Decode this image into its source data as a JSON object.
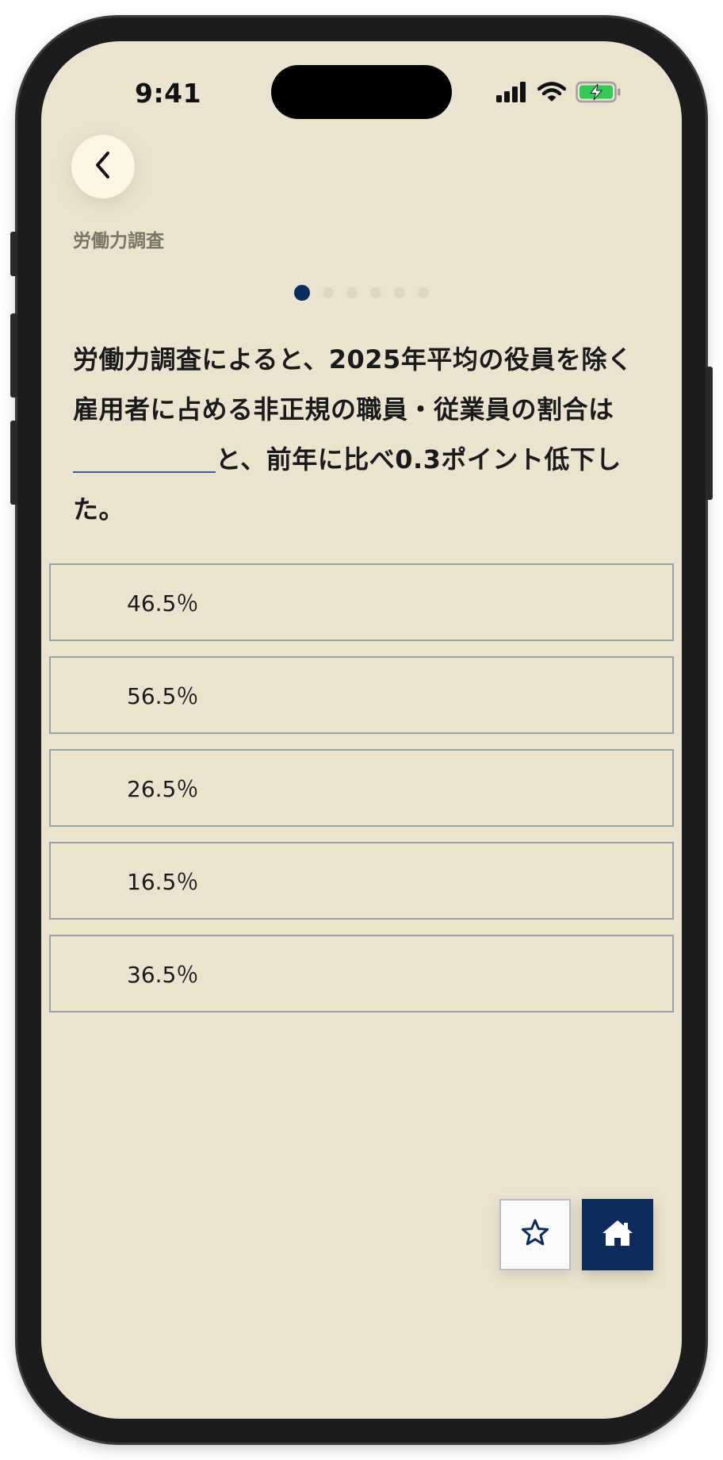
{
  "status_bar": {
    "time": "9:41",
    "icons": [
      "signal-icon",
      "wifi-icon",
      "battery-charging-icon"
    ]
  },
  "header": {
    "back_icon": "chevron-left-icon",
    "category": "労働力調査"
  },
  "pagination": {
    "total": 6,
    "current": 1
  },
  "question": {
    "text_before": "労働力調査によると、2025年平均の役員を除く雇用者に占める非正規の職員・従業員の割合は",
    "text_after": "と、前年に比べ0.3ポイント低下した。"
  },
  "options": [
    {
      "label": "46.5％"
    },
    {
      "label": "56.5％"
    },
    {
      "label": "26.5％"
    },
    {
      "label": "16.5％"
    },
    {
      "label": "36.5％"
    }
  ],
  "actions": {
    "favorite_icon": "star-outline-icon",
    "home_icon": "home-icon"
  },
  "colors": {
    "background": "#ece3cf",
    "accent": "#0d2c5c",
    "battery": "#34c759"
  }
}
